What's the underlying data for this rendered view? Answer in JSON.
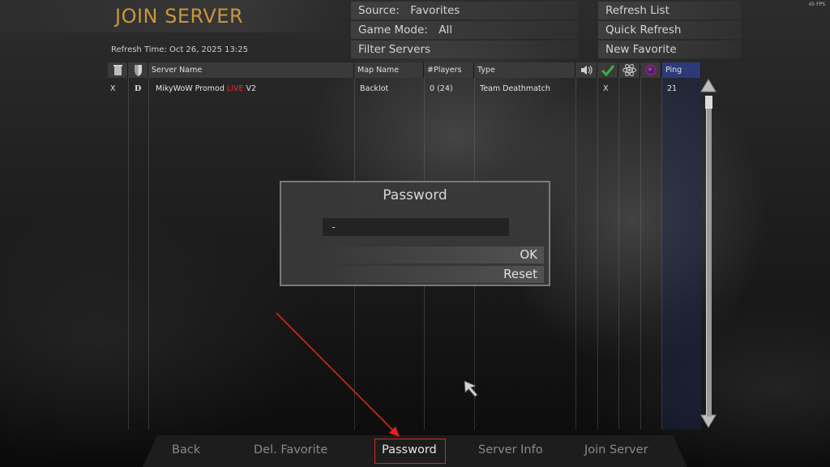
{
  "header": {
    "title": "JOIN SERVER",
    "fps": "45 FPS",
    "refresh_time": "Refresh Time: Oct 26, 2025  13:25"
  },
  "filters": {
    "source_label": "Source:",
    "source_value": "Favorites",
    "game_mode_label": "Game Mode:",
    "game_mode_value": "All",
    "filter_servers": "Filter Servers"
  },
  "actions": {
    "refresh_list": "Refresh List",
    "quick_refresh": "Quick Refresh",
    "new_favorite": "New Favorite"
  },
  "table": {
    "columns": {
      "server_name": "Server Name",
      "map_name": "Map Name",
      "players": "#Players",
      "type": "Type",
      "ping": "Ping"
    },
    "header_icons": [
      "trash-can-icon",
      "shield-icon",
      "speaker-icon",
      "checkmark-icon",
      "atom-icon",
      "globe-icon"
    ],
    "rows": [
      {
        "col1": "X",
        "col2": "D",
        "server_name": "MikyWoW Promod ",
        "server_name_live": "LIVE",
        "server_name_suffix": " V2",
        "map": "Backlot",
        "players": "0 (24)",
        "type": "Team Deathmatch",
        "check": "X",
        "ping": "21"
      }
    ]
  },
  "dialog": {
    "title": "Password",
    "input_value": "-",
    "ok": "OK",
    "reset": "Reset"
  },
  "bottom_bar": {
    "back": "Back",
    "del_favorite": "Del. Favorite",
    "password": "Password",
    "server_info": "Server Info",
    "join_server": "Join Server"
  },
  "colors": {
    "title": "#c9963c",
    "live": "#e0302a",
    "annotation": "#e2231a"
  }
}
